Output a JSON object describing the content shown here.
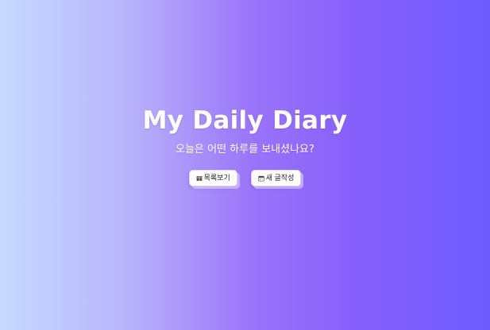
{
  "hero": {
    "title": "My Daily Diary",
    "subtitle": "오늘은 어떤 하루를 보내셨나요?"
  },
  "actions": {
    "list_label": "목록보기",
    "list_icon": "book-icon",
    "new_label": "새 글작성",
    "new_icon": "calendar-icon"
  },
  "colors": {
    "background_gradient": [
      "#c7d9ff",
      "#b9b6fb",
      "#9a73fa",
      "#8760fb",
      "#6e5bff"
    ],
    "text": "#ffffff",
    "button_background": "#ffffff"
  }
}
